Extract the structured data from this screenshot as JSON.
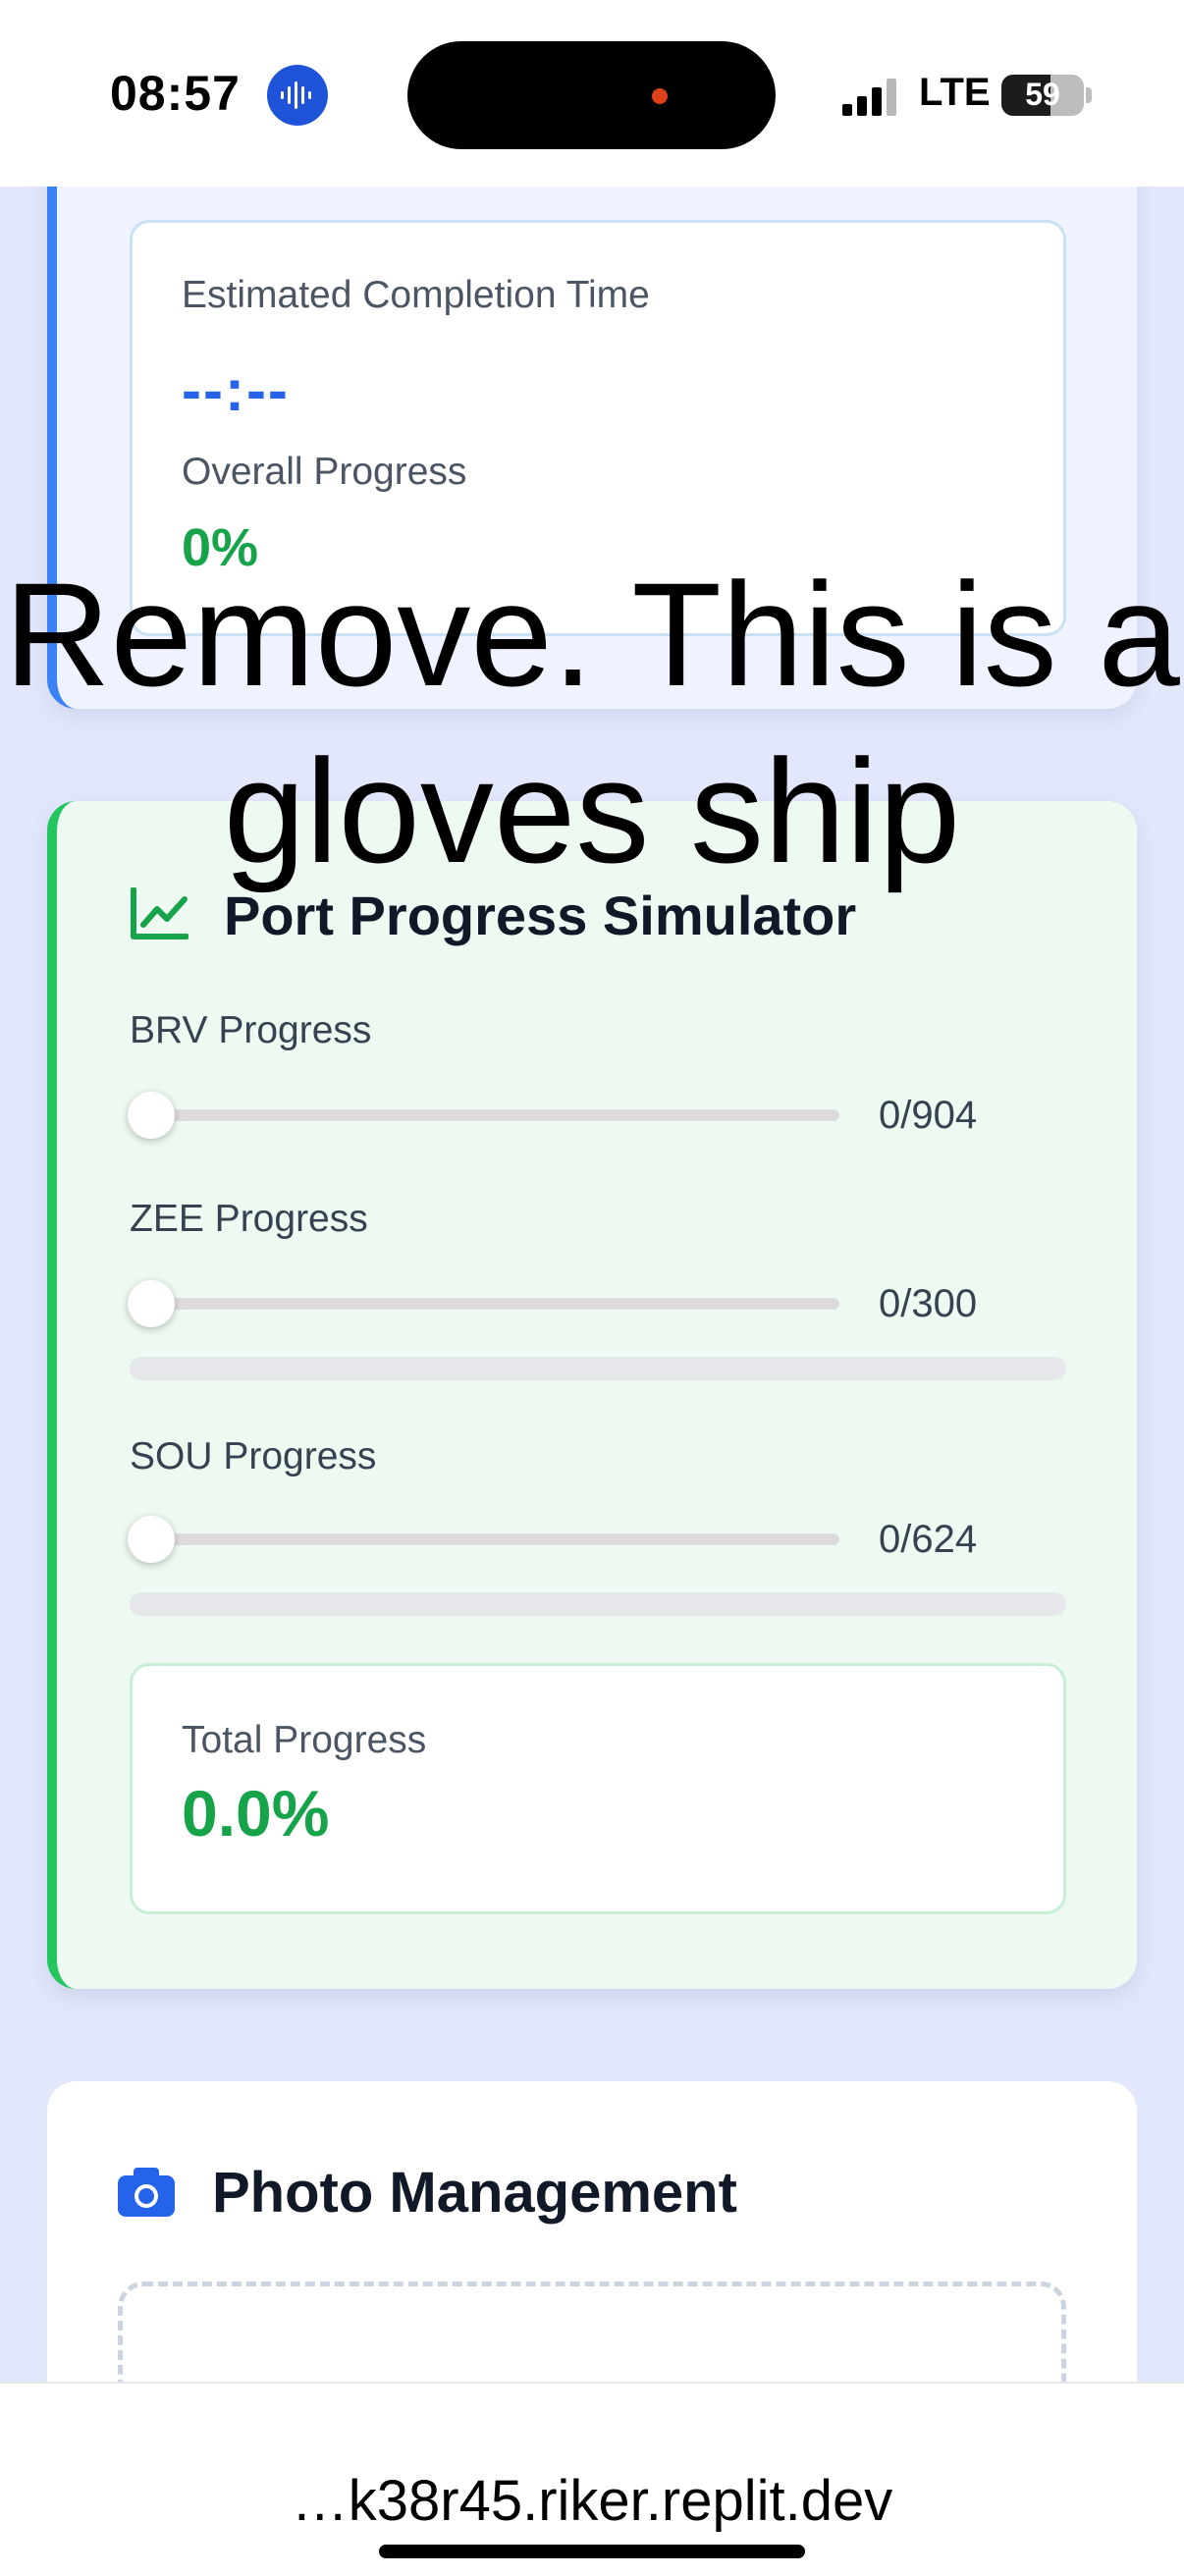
{
  "status_bar": {
    "time": "08:57",
    "network": "LTE",
    "battery": "59"
  },
  "timing_card": {
    "eta_label": "Estimated Completion Time",
    "eta_value": "--:--",
    "overall_label": "Overall Progress",
    "overall_value": "0%"
  },
  "overlay_note": "Remove. This is a gloves ship",
  "simulator": {
    "title": "Port Progress Simulator",
    "ports": [
      {
        "label": "BRV Progress",
        "count": "0/904",
        "value": 0,
        "max": 904
      },
      {
        "label": "ZEE Progress",
        "count": "0/300",
        "value": 0,
        "max": 300
      },
      {
        "label": "SOU Progress",
        "count": "0/624",
        "value": 0,
        "max": 624
      }
    ],
    "total_label": "Total Progress",
    "total_value": "0.0%"
  },
  "photos": {
    "title": "Photo Management"
  },
  "url_bar": {
    "url": "…k38r45.riker.replit.dev"
  }
}
